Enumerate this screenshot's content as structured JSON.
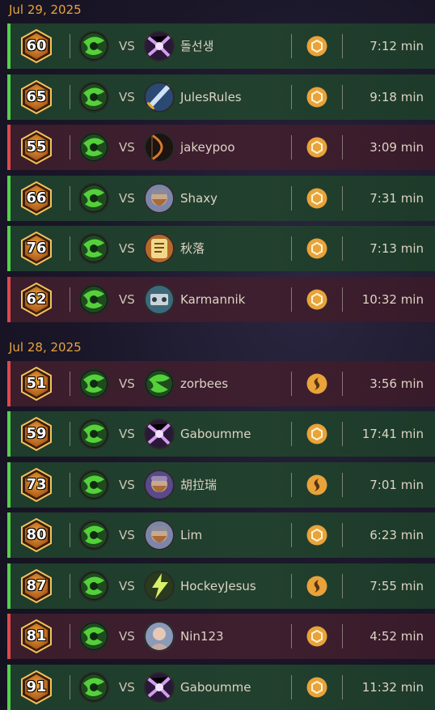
{
  "groups": [
    {
      "date": "Jul 29, 2025",
      "matches": [
        {
          "result": "win",
          "rank": "60",
          "vs": "VS",
          "opponent": "돌선생",
          "opp_hero": "purple-burst",
          "mode": "coin",
          "duration": "7:12 min"
        },
        {
          "result": "win",
          "rank": "65",
          "vs": "VS",
          "opponent": "JulesRules",
          "opp_hero": "blue-sword",
          "mode": "coin",
          "duration": "9:18 min"
        },
        {
          "result": "loss",
          "rank": "55",
          "vs": "VS",
          "opponent": "jakeypoo",
          "opp_hero": "dark-bow",
          "mode": "coin",
          "duration": "3:09 min"
        },
        {
          "result": "win",
          "rank": "66",
          "vs": "VS",
          "opponent": "Shaxy",
          "opp_hero": "dwarf",
          "mode": "coin",
          "duration": "7:31 min"
        },
        {
          "result": "win",
          "rank": "76",
          "vs": "VS",
          "opponent": "秋落",
          "opp_hero": "scroll",
          "mode": "coin",
          "duration": "7:13 min"
        },
        {
          "result": "loss",
          "rank": "62",
          "vs": "VS",
          "opponent": "Karmannik",
          "opp_hero": "mech",
          "mode": "coin",
          "duration": "10:32 min"
        }
      ]
    },
    {
      "date": "Jul 28, 2025",
      "matches": [
        {
          "result": "loss",
          "rank": "51",
          "vs": "VS",
          "opponent": "zorbees",
          "opp_hero": "green-orb",
          "mode": "swirl",
          "duration": "3:56 min"
        },
        {
          "result": "win",
          "rank": "59",
          "vs": "VS",
          "opponent": "Gaboumme",
          "opp_hero": "purple-burst",
          "mode": "coin",
          "duration": "17:41 min"
        },
        {
          "result": "win",
          "rank": "73",
          "vs": "VS",
          "opponent": "胡拉瑞",
          "opp_hero": "dwarf-purple",
          "mode": "swirl",
          "duration": "7:01 min"
        },
        {
          "result": "win",
          "rank": "80",
          "vs": "VS",
          "opponent": "Lim",
          "opp_hero": "dwarf",
          "mode": "coin",
          "duration": "6:23 min"
        },
        {
          "result": "win",
          "rank": "87",
          "vs": "VS",
          "opponent": "HockeyJesus",
          "opp_hero": "lightning",
          "mode": "swirl",
          "duration": "7:55 min"
        },
        {
          "result": "loss",
          "rank": "81",
          "vs": "VS",
          "opponent": "Nin123",
          "opp_hero": "portrait",
          "mode": "coin",
          "duration": "4:52 min"
        },
        {
          "result": "win",
          "rank": "91",
          "vs": "VS",
          "opponent": "Gaboumme",
          "opp_hero": "purple-burst",
          "mode": "coin",
          "duration": "11:32 min"
        }
      ]
    }
  ],
  "colors": {
    "win": "#53d14a",
    "loss": "#e0484a",
    "date": "#e7a340",
    "rank_hex": "#d9892a",
    "coin": "#e8a33a"
  }
}
